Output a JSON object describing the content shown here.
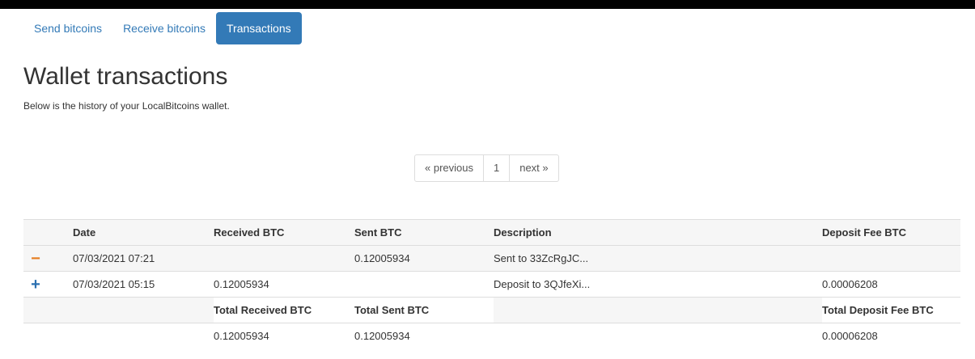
{
  "tabs": [
    {
      "label": "Send bitcoins",
      "active": false
    },
    {
      "label": "Receive bitcoins",
      "active": false
    },
    {
      "label": "Transactions",
      "active": true
    }
  ],
  "page": {
    "title": "Wallet transactions",
    "description": "Below is the history of your LocalBitcoins wallet."
  },
  "pagination": {
    "previous": "« previous",
    "current": "1",
    "next": "next »"
  },
  "table": {
    "headers": [
      "",
      "Date",
      "Received BTC",
      "Sent BTC",
      "Description",
      "Deposit Fee BTC"
    ],
    "rows": [
      {
        "type": "outgoing",
        "icon": "minus-icon",
        "sign": "−",
        "date": "07/03/2021 07:21",
        "received": "",
        "sent": "0.12005934",
        "description": "Sent to 33ZcRgJC...",
        "fee": ""
      },
      {
        "type": "incoming",
        "icon": "plus-icon",
        "sign": "+",
        "date": "07/03/2021 05:15",
        "received": "0.12005934",
        "sent": "",
        "description": "Deposit to 3QJfeXi...",
        "fee": "0.00006208"
      }
    ],
    "totals_headers": {
      "received": "Total Received BTC",
      "sent": "Total Sent BTC",
      "fee": "Total Deposit Fee BTC"
    },
    "totals": {
      "received": "0.12005934",
      "sent": "0.12005934",
      "fee": "0.00006208"
    }
  },
  "colors": {
    "accent": "#337ab7",
    "minus": "#e67e22",
    "plus": "#2a6fb0",
    "stripe": "#f6f6f6"
  }
}
